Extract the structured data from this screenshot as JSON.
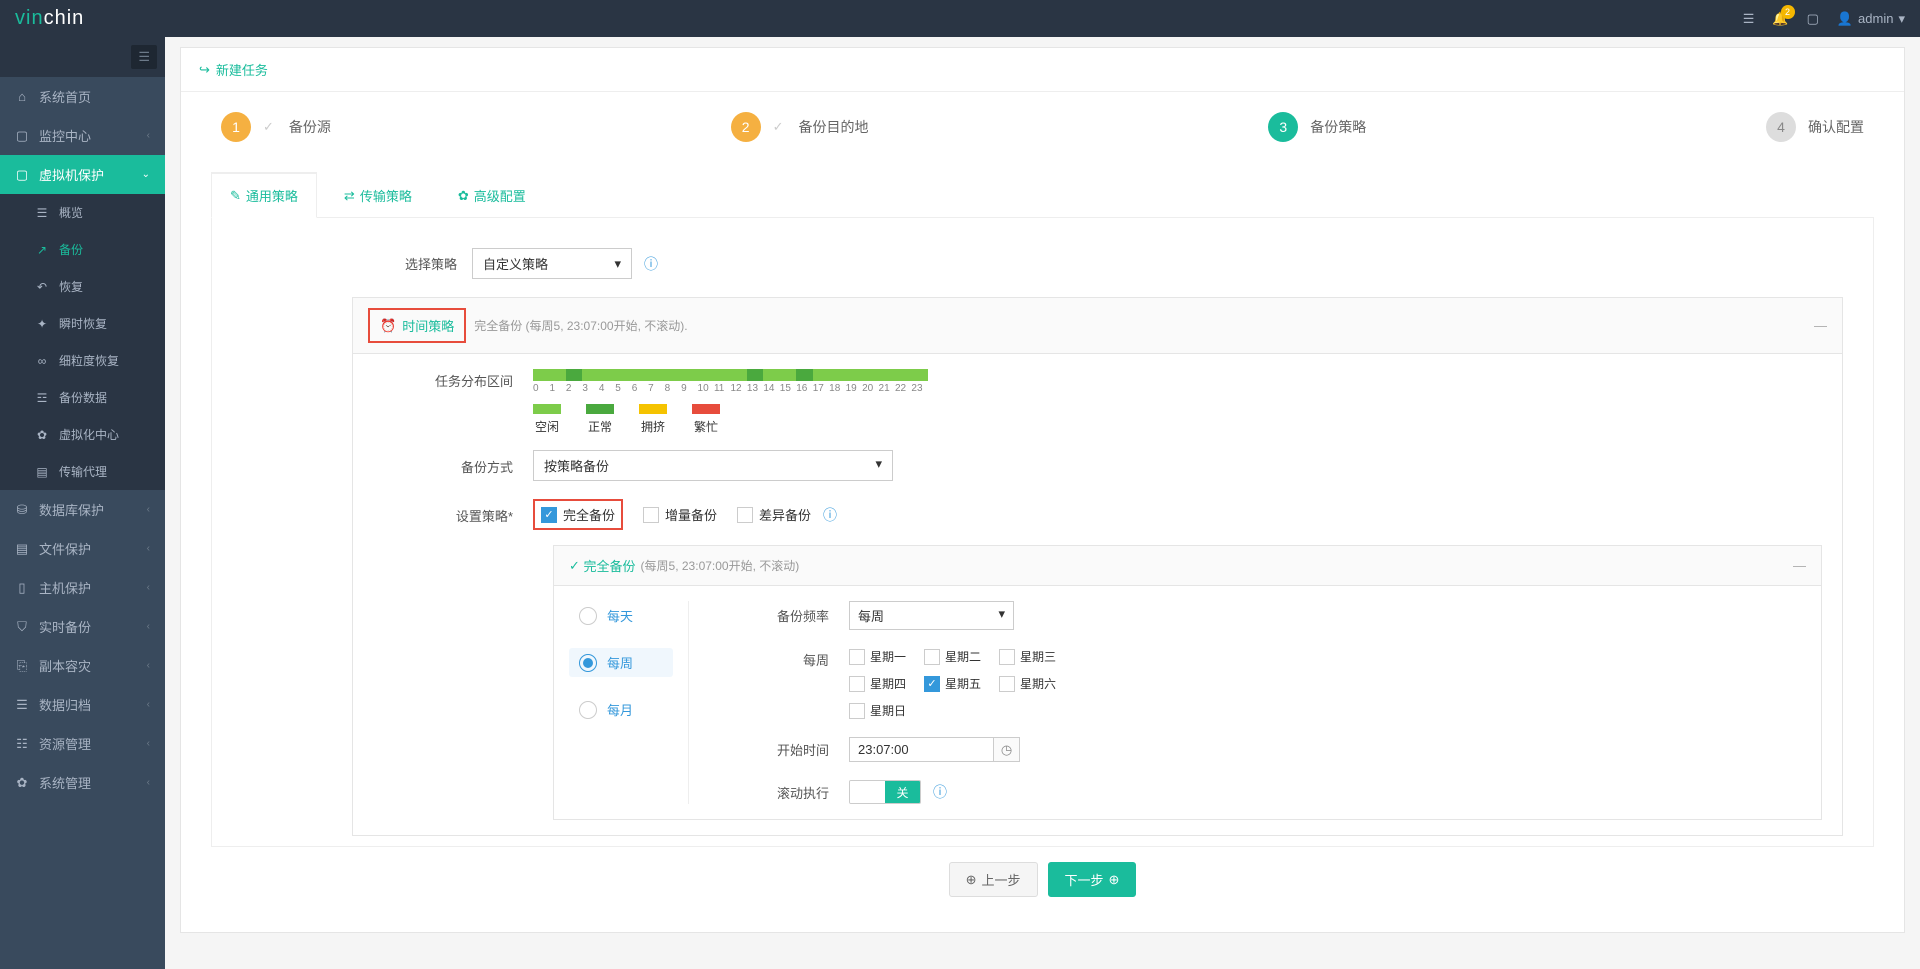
{
  "header": {
    "logo_prefix": "vin",
    "logo_suffix": "chin",
    "notif_count": "2",
    "user": "admin"
  },
  "sidebar": {
    "items": [
      {
        "label": "系统首页",
        "icon": "⌂"
      },
      {
        "label": "监控中心",
        "icon": "▢",
        "expandable": true
      },
      {
        "label": "虚拟机保护",
        "icon": "▢",
        "expandable": true,
        "active": true,
        "children": [
          {
            "label": "概览",
            "icon": "☰"
          },
          {
            "label": "备份",
            "icon": "↗",
            "current": true
          },
          {
            "label": "恢复",
            "icon": "↶"
          },
          {
            "label": "瞬时恢复",
            "icon": "✦"
          },
          {
            "label": "细粒度恢复",
            "icon": "∞"
          },
          {
            "label": "备份数据",
            "icon": "☲"
          },
          {
            "label": "虚拟化中心",
            "icon": "✿"
          },
          {
            "label": "传输代理",
            "icon": "▤"
          }
        ]
      },
      {
        "label": "数据库保护",
        "icon": "⛁",
        "expandable": true
      },
      {
        "label": "文件保护",
        "icon": "▤",
        "expandable": true
      },
      {
        "label": "主机保护",
        "icon": "▯",
        "expandable": true
      },
      {
        "label": "实时备份",
        "icon": "⛉",
        "expandable": true
      },
      {
        "label": "副本容灾",
        "icon": "⎘",
        "expandable": true
      },
      {
        "label": "数据归档",
        "icon": "☰",
        "expandable": true
      },
      {
        "label": "资源管理",
        "icon": "☷",
        "expandable": true
      },
      {
        "label": "系统管理",
        "icon": "✿",
        "expandable": true
      }
    ]
  },
  "panel": {
    "title": "新建任务"
  },
  "wizard": {
    "steps": [
      {
        "num": "1",
        "label": "备份源",
        "state": "done",
        "check": true
      },
      {
        "num": "2",
        "label": "备份目的地",
        "state": "done",
        "check": true
      },
      {
        "num": "3",
        "label": "备份策略",
        "state": "active"
      },
      {
        "num": "4",
        "label": "确认配置",
        "state": "pending"
      }
    ]
  },
  "tabs": [
    {
      "label": "通用策略",
      "icon": "✎",
      "active": true
    },
    {
      "label": "传输策略",
      "icon": "⇄"
    },
    {
      "label": "高级配置",
      "icon": "✿"
    }
  ],
  "form": {
    "select_strategy_label": "选择策略",
    "select_strategy_value": "自定义策略",
    "time_strategy": {
      "title": "时间策略",
      "subtitle": "完全备份 (每周5, 23:07:00开始, 不滚动).",
      "dist_label": "任务分布区间",
      "hours": [
        "0",
        "1",
        "2",
        "3",
        "4",
        "5",
        "6",
        "7",
        "8",
        "9",
        "10",
        "11",
        "12",
        "13",
        "14",
        "15",
        "16",
        "17",
        "18",
        "19",
        "20",
        "21",
        "22",
        "23"
      ],
      "legend": [
        {
          "label": "空闲",
          "cls": "seg-idle"
        },
        {
          "label": "正常",
          "cls": "seg-normal"
        },
        {
          "label": "拥挤",
          "cls": "seg-crowd"
        },
        {
          "label": "繁忙",
          "cls": "seg-busy"
        }
      ],
      "backup_mode_label": "备份方式",
      "backup_mode_value": "按策略备份",
      "set_strategy_label": "设置策略",
      "types": [
        {
          "label": "完全备份",
          "checked": true,
          "highlight": true
        },
        {
          "label": "增量备份",
          "checked": false
        },
        {
          "label": "差异备份",
          "checked": false
        }
      ],
      "full_panel": {
        "title": "完全备份",
        "subtitle": "(每周5, 23:07:00开始, 不滚动)",
        "freq_options": [
          {
            "label": "每天"
          },
          {
            "label": "每周",
            "selected": true
          },
          {
            "label": "每月"
          }
        ],
        "freq_label": "备份频率",
        "freq_value": "每周",
        "week_label": "每周",
        "weekdays": [
          {
            "label": "星期一"
          },
          {
            "label": "星期二"
          },
          {
            "label": "星期三"
          },
          {
            "label": "星期四"
          },
          {
            "label": "星期五",
            "checked": true
          },
          {
            "label": "星期六"
          },
          {
            "label": "星期日"
          }
        ],
        "start_label": "开始时间",
        "start_value": "23:07:00",
        "roll_label": "滚动执行",
        "roll_off": "关"
      }
    }
  },
  "footer": {
    "prev": "上一步",
    "next": "下一步"
  }
}
